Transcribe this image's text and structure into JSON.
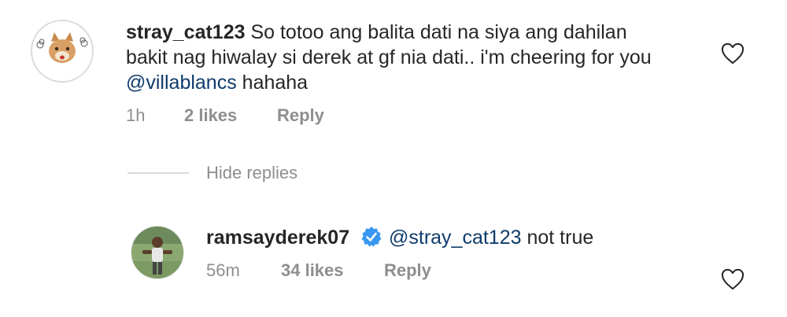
{
  "comment": {
    "username": "stray_cat123",
    "line1": " So totoo ang balita dati na siya ang dahilan",
    "line2": "bakit nag hiwalay  si derek at gf nia dati.. i'm cheering for you",
    "mention": "@villablancs",
    "line3_rest": " hahaha",
    "time": "1h",
    "likes": "2 likes",
    "reply": "Reply"
  },
  "toggle": {
    "label": "Hide replies"
  },
  "reply_comment": {
    "username": "ramsayderek07",
    "mention": "@stray_cat123",
    "text": " not true",
    "time": "56m",
    "likes": "34 likes",
    "reply": "Reply"
  },
  "icons": {
    "heart": "heart-outline-icon",
    "verified": "verified-badge-icon"
  },
  "colors": {
    "mention": "#0f3b6b",
    "meta": "#8e8e8e",
    "verified": "#3897f0"
  }
}
